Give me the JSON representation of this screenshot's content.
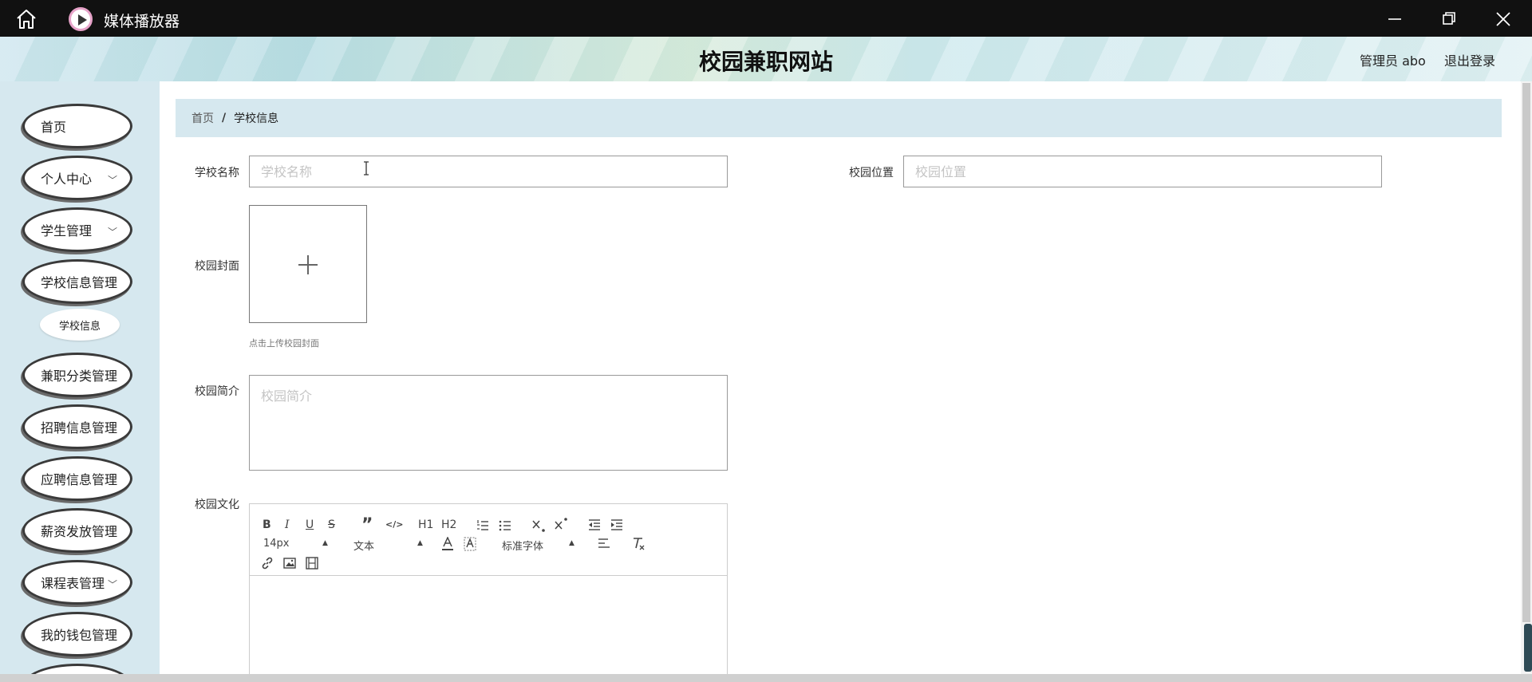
{
  "window": {
    "app_title": "媒体播放器"
  },
  "header": {
    "site_title": "校园兼职网站",
    "user": "管理员 abo",
    "logout": "退出登录"
  },
  "sidebar": {
    "items": [
      {
        "label": "首页"
      },
      {
        "label": "个人中心",
        "expandable": true
      },
      {
        "label": "学生管理",
        "expandable": true
      },
      {
        "label": "学校信息管理"
      },
      {
        "label": "兼职分类管理"
      },
      {
        "label": "招聘信息管理"
      },
      {
        "label": "应聘信息管理"
      },
      {
        "label": "薪资发放管理"
      },
      {
        "label": "课程表管理",
        "expandable": true
      },
      {
        "label": "我的钱包管理"
      }
    ],
    "sub_item": "学校信息"
  },
  "breadcrumb": {
    "home": "首页",
    "separator": "/",
    "current": "学校信息"
  },
  "form": {
    "school_name_label": "学校名称",
    "school_name_placeholder": "学校名称",
    "location_label": "校园位置",
    "location_placeholder": "校园位置",
    "cover_label": "校园封面",
    "cover_tip": "点击上传校园封面",
    "intro_label": "校园简介",
    "intro_placeholder": "校园简介",
    "culture_label": "校园文化"
  },
  "editor": {
    "bold": "B",
    "italic": "I",
    "underline": "U",
    "strike": "S",
    "quote": "”",
    "code": "</>",
    "h1": "H1",
    "h2": "H2",
    "size": "14px",
    "text_style": "文本",
    "font": "标准字体"
  }
}
